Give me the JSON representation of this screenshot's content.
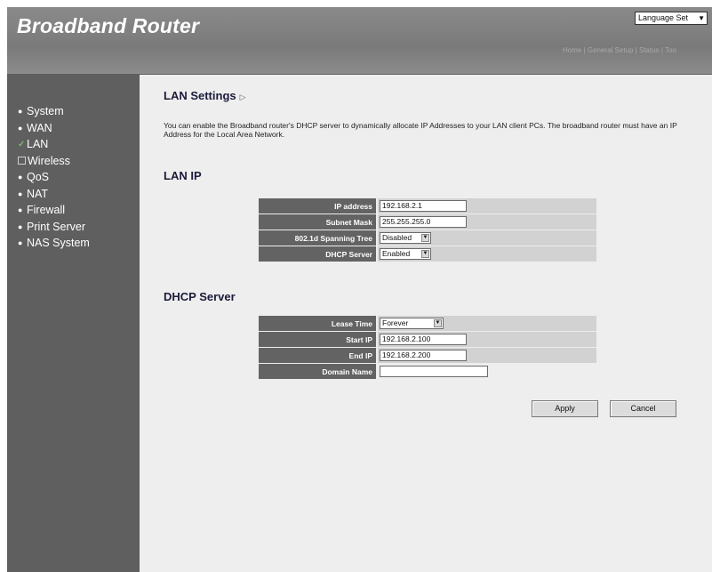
{
  "header": {
    "title": "Broadband Router",
    "language_select": "Language Set",
    "top_links": "Home | General Setup | Status | Too"
  },
  "sidebar": {
    "items": [
      {
        "label": "System"
      },
      {
        "label": "WAN"
      },
      {
        "label": "LAN"
      },
      {
        "label": "Wireless"
      },
      {
        "label": "QoS"
      },
      {
        "label": "NAT"
      },
      {
        "label": "Firewall"
      },
      {
        "label": "Print Server"
      },
      {
        "label": "NAS System"
      }
    ]
  },
  "main": {
    "title": "LAN Settings",
    "description": "You can enable the Broadband router's DHCP server to dynamically allocate IP Addresses to your LAN client PCs. The broadband router must have an IP Address for the Local Area Network.",
    "lan_ip": {
      "title": "LAN IP",
      "ip_address": {
        "label": "IP address",
        "value": "192.168.2.1"
      },
      "subnet_mask": {
        "label": "Subnet Mask",
        "value": "255.255.255.0"
      },
      "spanning_tree": {
        "label": "802.1d Spanning Tree",
        "value": "Disabled"
      },
      "dhcp_server": {
        "label": "DHCP Server",
        "value": "Enabled"
      }
    },
    "dhcp": {
      "title": "DHCP Server",
      "lease_time": {
        "label": "Lease Time",
        "value": "Forever"
      },
      "start_ip": {
        "label": "Start IP",
        "value": "192.168.2.100"
      },
      "end_ip": {
        "label": "End IP",
        "value": "192.168.2.200"
      },
      "domain_name": {
        "label": "Domain Name",
        "value": ""
      }
    },
    "buttons": {
      "apply": "Apply",
      "cancel": "Cancel"
    }
  },
  "colors": {
    "sidebar_bg": "#5f5f5f",
    "header_bg": "#7d7d7d",
    "label_bg": "#636363",
    "value_bg": "#d2d2d2"
  }
}
